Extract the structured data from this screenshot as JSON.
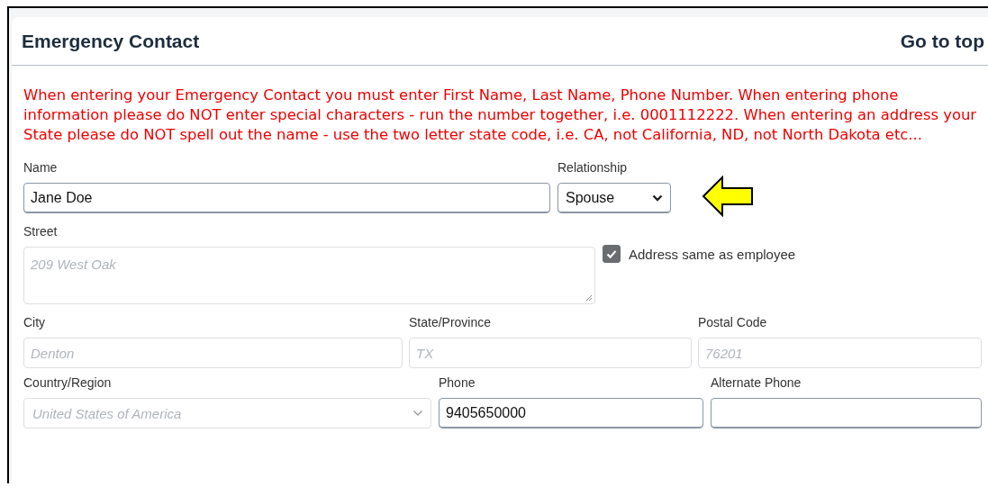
{
  "section": {
    "title": "Emergency Contact",
    "top_link": "Go to top"
  },
  "notice": "When entering your Emergency Contact you must enter First Name, Last Name, Phone Number. When entering phone information please do NOT enter special characters - run the number together, i.e. 0001112222. When entering an address your State please do NOT spell out the name - use the two letter state code, i.e. CA, not California, ND, not North Dakota etc...",
  "rows": [
    {
      "fields": [
        {
          "kind": "text",
          "label": "Name",
          "value": "Jane Doe",
          "disabled": false
        },
        {
          "kind": "select",
          "label": "Relationship",
          "value": "Spouse",
          "disabled": false
        }
      ]
    },
    {
      "fields": [
        {
          "kind": "textarea",
          "label": "Street",
          "value": "209 West Oak",
          "disabled": true
        },
        {
          "kind": "checkbox",
          "label": "Address same as employee",
          "checked": true
        }
      ]
    },
    {
      "fields": [
        {
          "kind": "text",
          "label": "City",
          "value": "Denton",
          "disabled": true
        },
        {
          "kind": "text",
          "label": "State/Province",
          "value": "TX",
          "disabled": true
        },
        {
          "kind": "text",
          "label": "Postal Code",
          "value": "76201",
          "disabled": true
        }
      ]
    },
    {
      "fields": [
        {
          "kind": "select",
          "label": "Country/Region",
          "value": "United States of America",
          "disabled": true
        },
        {
          "kind": "text",
          "label": "Phone",
          "value": "9405650000",
          "disabled": false
        },
        {
          "kind": "text",
          "label": "Alternate Phone",
          "disabled": false
        }
      ]
    }
  ]
}
